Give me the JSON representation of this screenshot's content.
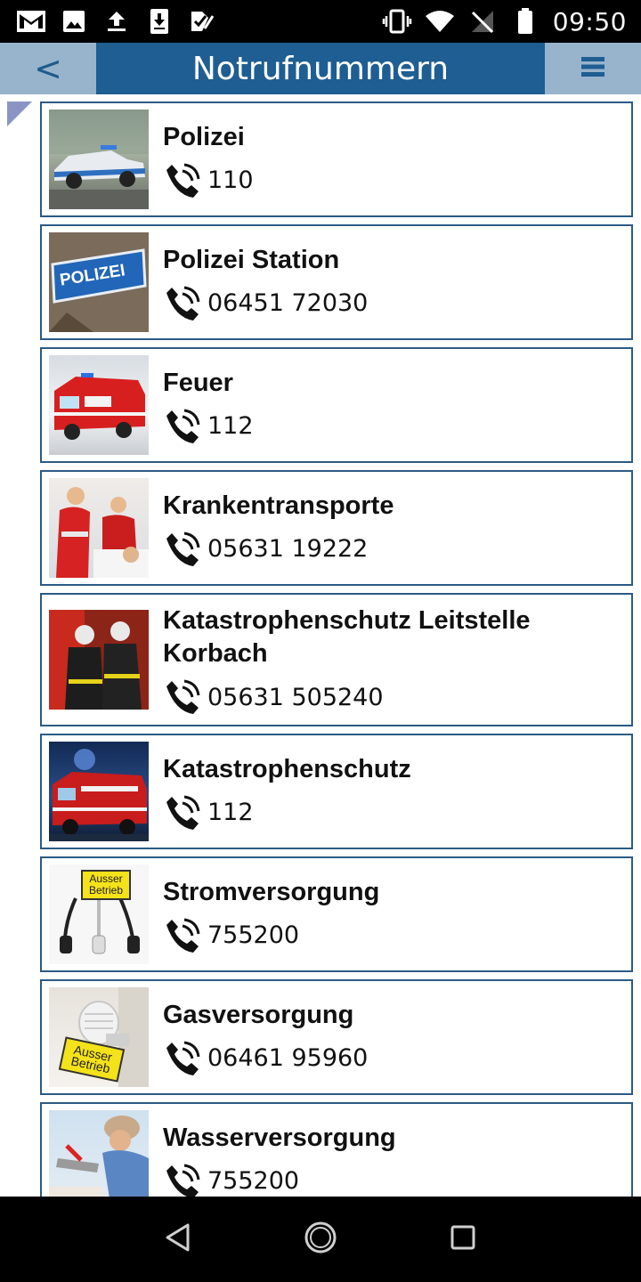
{
  "status_bar": {
    "time": "09:50",
    "left_icons": [
      "gmail-icon",
      "image-icon",
      "upload-icon",
      "download-icon",
      "check-icon"
    ],
    "right_icons": [
      "vibrate-icon",
      "wifi-icon",
      "no-signal-icon",
      "battery-icon"
    ]
  },
  "header": {
    "back_label": "<",
    "title": "Notrufnummern",
    "menu_icon": "hamburger-menu-icon"
  },
  "entries": [
    {
      "name": "Polizei",
      "number": "110",
      "image": "police-car"
    },
    {
      "name": "Polizei Station",
      "number": "06451 72030",
      "image": "police-sign"
    },
    {
      "name": "Feuer",
      "number": "112",
      "image": "fire-truck"
    },
    {
      "name": "Krankentransporte",
      "number": "05631 19222",
      "image": "paramedics"
    },
    {
      "name": "Katastrophenschutz Leitstelle Korbach",
      "number": "05631 505240",
      "image": "firefighters"
    },
    {
      "name": "Katastrophenschutz",
      "number": "112",
      "image": "fire-engine-night"
    },
    {
      "name": "Stromversorgung",
      "number": "755200",
      "image": "power-plugs"
    },
    {
      "name": "Gasversorgung",
      "number": "06461 95960",
      "image": "gas-thermostat"
    },
    {
      "name": "Wasserversorgung",
      "number": "755200",
      "image": "plumber"
    }
  ],
  "thumb_text": {
    "police_sign": "POLIZEI",
    "strom_sign": "Ausser Betrieb",
    "gas_sign": "Ausser Betrieb"
  },
  "colors": {
    "header_title_bg": "#1e5e92",
    "header_side_bg": "#98b3cc",
    "card_border": "#2b5a85"
  },
  "nav": [
    "back-nav-icon",
    "home-nav-icon",
    "recents-nav-icon"
  ]
}
